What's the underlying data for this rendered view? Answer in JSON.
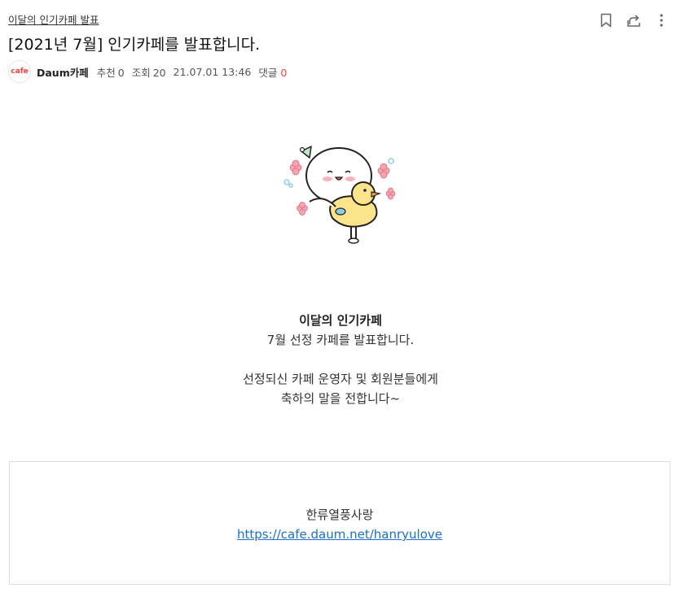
{
  "header": {
    "breadcrumb": "이달의 인기카페 발표",
    "title": "[2021년 7월] 인기카페를 발표합니다.",
    "icons": [
      "bookmark-icon",
      "share-icon",
      "more-icon"
    ]
  },
  "meta": {
    "logo_text": "cafe",
    "author": "Daum카페",
    "recommend_label": "추천",
    "recommend_count": "0",
    "views_label": "조회",
    "views_count": "20",
    "datetime": "21.07.01 13:46",
    "comments_label": "댓글",
    "comments_count": "0"
  },
  "body": {
    "heading": "이달의 인기카페",
    "line1": "7월 선정 카페를 발표합니다.",
    "line2": "선정되신 카페 운영자 및 회원분들에게",
    "line3": "축하의 말을 전합니다~"
  },
  "link_card": {
    "name": "한류열풍사랑",
    "url": "https://cafe.daum.net/hanryulove"
  },
  "colors": {
    "accent_red": "#ff4141",
    "link_blue": "#1a6fcc"
  }
}
